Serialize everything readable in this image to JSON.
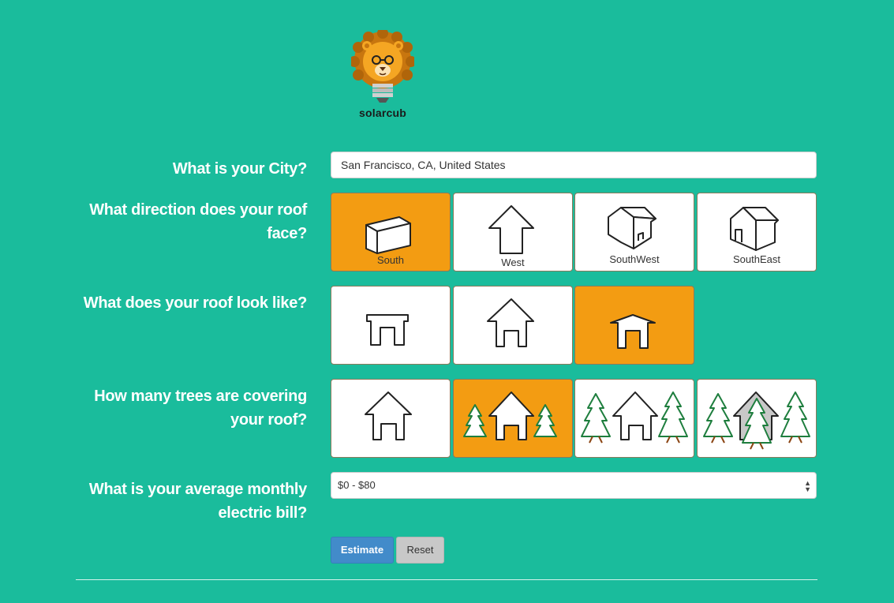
{
  "logo": {
    "name": "solarcub"
  },
  "questions": {
    "city": "What is your City?",
    "direction_line1": "What direction does your roof",
    "direction_line2": "face?",
    "roof": "What does your roof look like?",
    "trees_line1": "How many trees are covering",
    "trees_line2": "your roof?",
    "bill_line1": "What is your average monthly",
    "bill_line2": "electric bill?"
  },
  "city_input": {
    "value": "San Francisco, CA, United States"
  },
  "direction_options": [
    {
      "label": "South",
      "selected": true
    },
    {
      "label": "West",
      "selected": false
    },
    {
      "label": "SouthWest",
      "selected": false
    },
    {
      "label": "SouthEast",
      "selected": false
    }
  ],
  "roof_options": [
    {
      "icon": "flat-roof-icon",
      "selected": false
    },
    {
      "icon": "pitched-roof-icon",
      "selected": false
    },
    {
      "icon": "low-pitched-roof-icon",
      "selected": true
    }
  ],
  "tree_options": [
    {
      "icon": "no-trees-icon",
      "selected": false
    },
    {
      "icon": "few-trees-icon",
      "selected": true
    },
    {
      "icon": "some-trees-icon",
      "selected": false
    },
    {
      "icon": "many-trees-icon",
      "selected": false
    }
  ],
  "bill_select": {
    "value": "$0 - $80"
  },
  "buttons": {
    "estimate": "Estimate",
    "reset": "Reset"
  },
  "colors": {
    "background": "#1abc9c",
    "selected": "#f39c12",
    "primary": "#428bca"
  }
}
